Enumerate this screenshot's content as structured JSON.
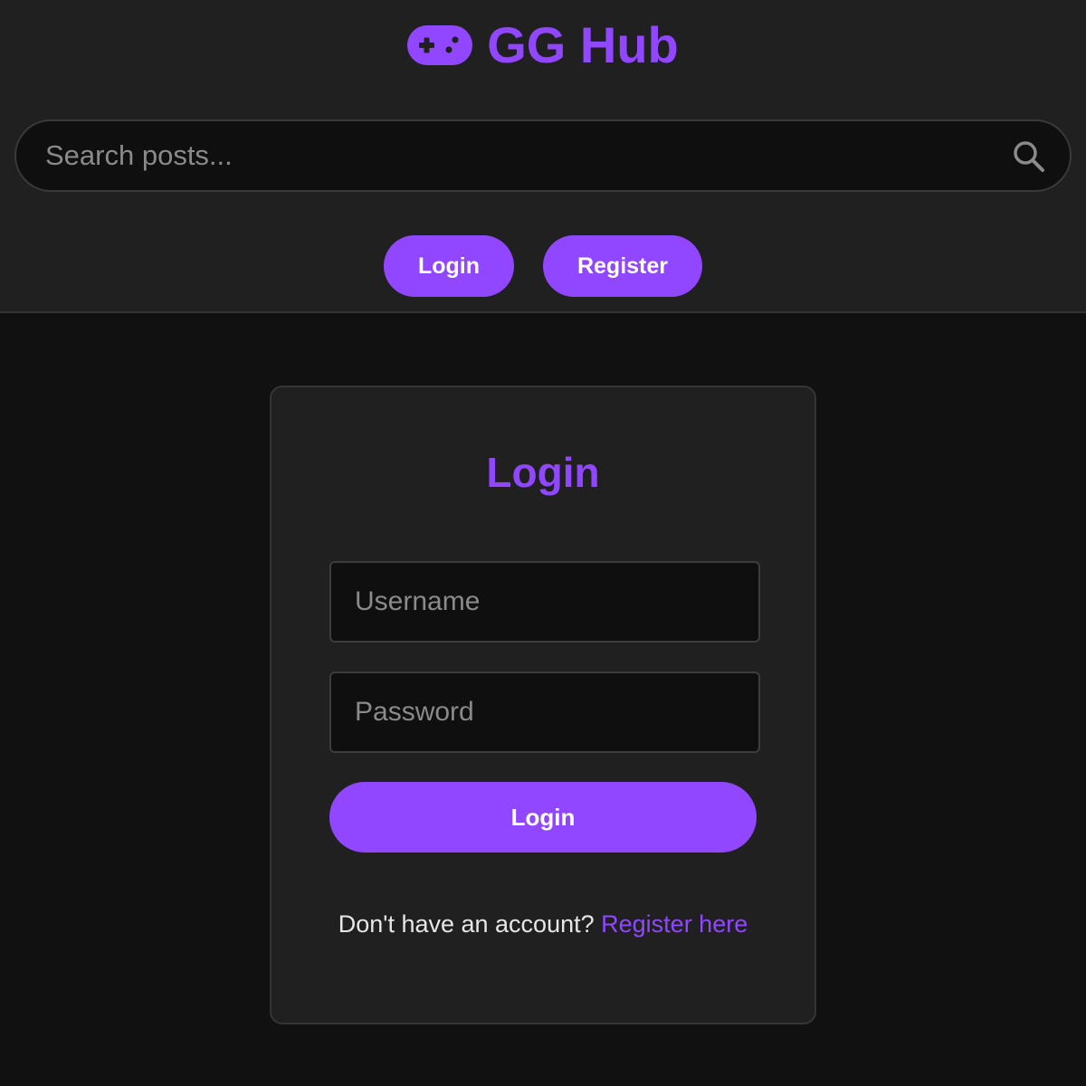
{
  "header": {
    "brand": {
      "title": "GG Hub",
      "icon": "gamepad-icon"
    },
    "search": {
      "placeholder": "Search posts...",
      "value": "",
      "icon": "search-icon"
    },
    "nav": {
      "login_label": "Login",
      "register_label": "Register"
    }
  },
  "login_form": {
    "title": "Login",
    "username_placeholder": "Username",
    "password_placeholder": "Password",
    "submit_label": "Login",
    "footer_text": "Don't have an account?",
    "footer_link": "Register here"
  },
  "colors": {
    "accent": "#9146ff",
    "header_bg": "#202020",
    "page_bg": "#111111",
    "input_bg": "#0f0f0f"
  }
}
